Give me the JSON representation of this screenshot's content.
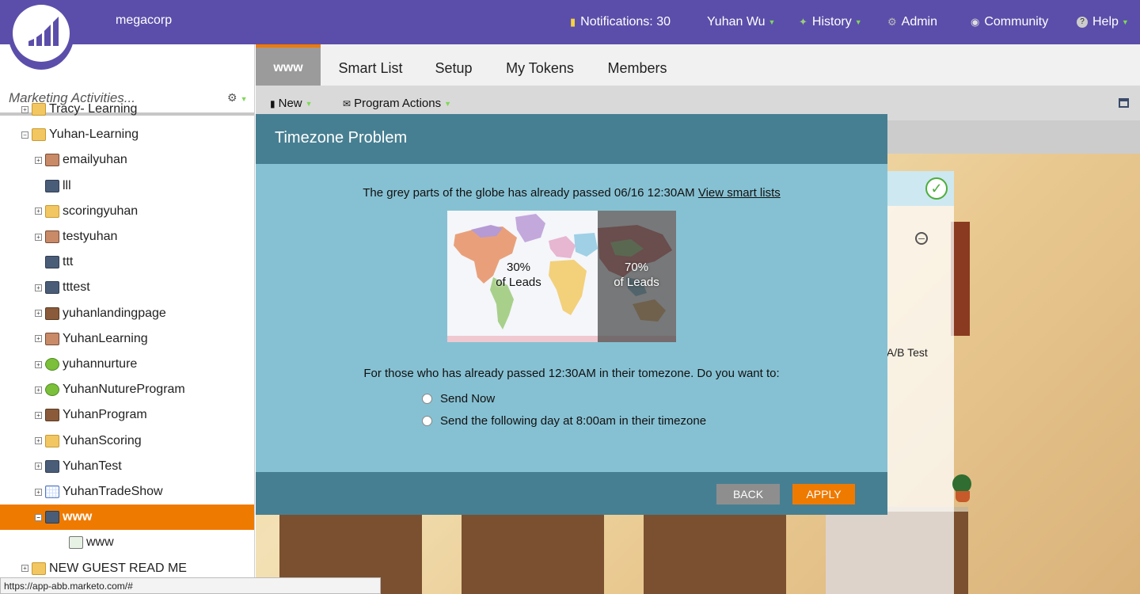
{
  "app": {
    "company": "megacorp"
  },
  "topnav": {
    "notifications": "Notifications: 30",
    "user": "Yuhan Wu",
    "history": "History",
    "admin": "Admin",
    "community": "Community",
    "help": "Help"
  },
  "sidebar": {
    "search_placeholder": "Marketing Activities...",
    "items": [
      {
        "label": "Tracy- Learning",
        "icon": "folder-icon",
        "indent": 1
      },
      {
        "label": "Yuhan-Learning",
        "icon": "folder-icon",
        "indent": 1
      },
      {
        "label": "emailyuhan",
        "icon": "program-icon",
        "indent": 2
      },
      {
        "label": "lll",
        "icon": "email-program-icon",
        "indent": 2
      },
      {
        "label": "scoringyuhan",
        "icon": "folder-icon",
        "indent": 2
      },
      {
        "label": "testyuhan",
        "icon": "program-icon",
        "indent": 2
      },
      {
        "label": "ttt",
        "icon": "email-program-icon",
        "indent": 2
      },
      {
        "label": "tttest",
        "icon": "email-program-icon",
        "indent": 2
      },
      {
        "label": "yuhanlandingpage",
        "icon": "landing-program-icon",
        "indent": 2
      },
      {
        "label": "YuhanLearning",
        "icon": "program-icon",
        "indent": 2
      },
      {
        "label": "yuhannurture",
        "icon": "nurture-program-icon",
        "indent": 2
      },
      {
        "label": "YuhanNutureProgram",
        "icon": "nurture-program-icon",
        "indent": 2
      },
      {
        "label": "YuhanProgram",
        "icon": "landing-program-icon",
        "indent": 2
      },
      {
        "label": "YuhanScoring",
        "icon": "folder-icon",
        "indent": 2
      },
      {
        "label": "YuhanTest",
        "icon": "email-program-icon",
        "indent": 2
      },
      {
        "label": "YuhanTradeShow",
        "icon": "event-program-icon",
        "indent": 2
      },
      {
        "label": "www",
        "icon": "email-program-icon",
        "indent": 2,
        "selected": true
      },
      {
        "label": "www",
        "icon": "smart-campaign-icon",
        "indent": 3
      },
      {
        "label": "NEW GUEST READ ME",
        "icon": "folder-icon",
        "indent": 1
      }
    ]
  },
  "status_url": "https://app-abb.marketo.com/#",
  "tabs": [
    "www",
    "Smart List",
    "Setup",
    "My Tokens",
    "Members"
  ],
  "toolbar": {
    "new_label": "New",
    "program_actions_label": "Program Actions"
  },
  "background": {
    "ab_test_label": "d A/B Test"
  },
  "modal": {
    "title": "Timezone Problem",
    "line1_text": "The grey parts of the globe has already passed 06/16 12:30AM ",
    "line1_link": "View smart lists",
    "left_percent": "30%",
    "left_caption": "of Leads",
    "right_percent": "70%",
    "right_caption": "of Leads",
    "question": "For those who has already passed 12:30AM in their tomezone. Do you want to:",
    "option1": "Send Now",
    "option2": "Send the following day at 8:00am in their timezone",
    "back_label": "BACK",
    "apply_label": "APPLY"
  }
}
